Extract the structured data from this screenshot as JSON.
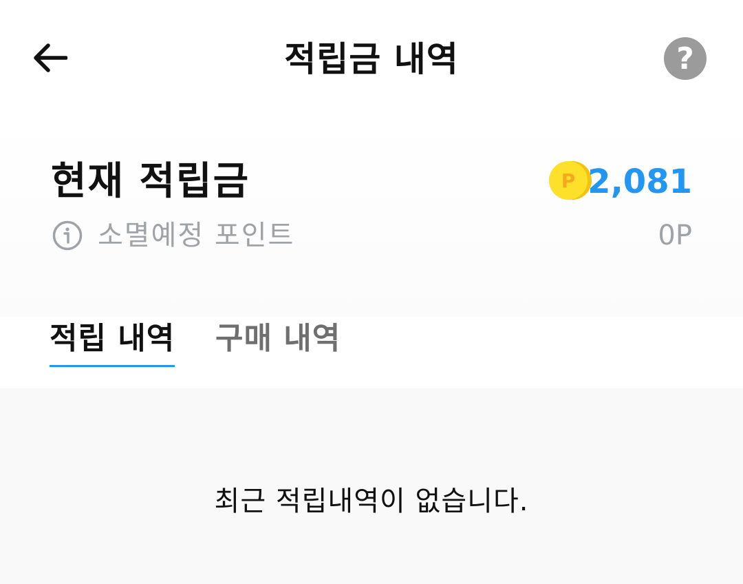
{
  "header": {
    "title": "적립금 내역",
    "back_icon": "arrow-left-icon",
    "help_icon": "question-circle-icon",
    "help_glyph": "?"
  },
  "summary": {
    "label": "현재 적립금",
    "coin_icon": "point-coin-icon",
    "coin_letter": "P",
    "balance": "2,081",
    "expiring_label": "소멸예정 포인트",
    "expiring_value": "0P",
    "info_icon": "info-circle-icon"
  },
  "tabs": [
    {
      "label": "적립 내역",
      "active": true
    },
    {
      "label": "구매 내역",
      "active": false
    }
  ],
  "content": {
    "empty_message": "최근 적립내역이 없습니다."
  },
  "colors": {
    "accent": "#2196f3",
    "muted": "#9ea3a8",
    "coin": "#fde02a"
  }
}
